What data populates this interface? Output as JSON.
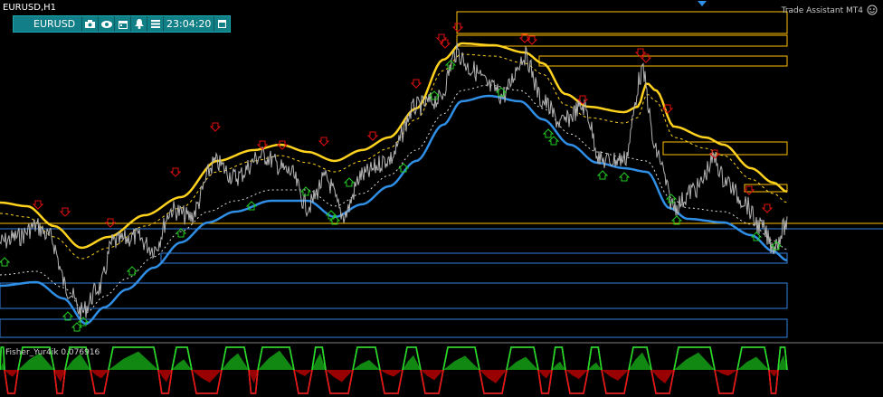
{
  "chart": {
    "title": "EURUSD,H1",
    "symbol": "EURUSD",
    "time": "23:04:20",
    "assistant_label": "Trade Assistant MT4",
    "indicator_label": "Fisher_Yur4ik 0.076916",
    "colors": {
      "background": "#000000",
      "price": "#b4b4b4",
      "upper_band": "#ffd21e",
      "lower_band": "#2f8fe6",
      "resistance_zone": "#ffc000",
      "support_zone": "#2f7fe0",
      "sell_arrow": "#e01010",
      "buy_arrow": "#22cc22",
      "fisher_up": "#22dd22",
      "fisher_down": "#ee1111",
      "toolbar": "#117f86"
    }
  },
  "toolbar_icons": [
    "eurusd-icon",
    "camera-icon",
    "eye-icon",
    "calendar-icon",
    "bell-icon",
    "menu-icon",
    "window-icon"
  ]
}
